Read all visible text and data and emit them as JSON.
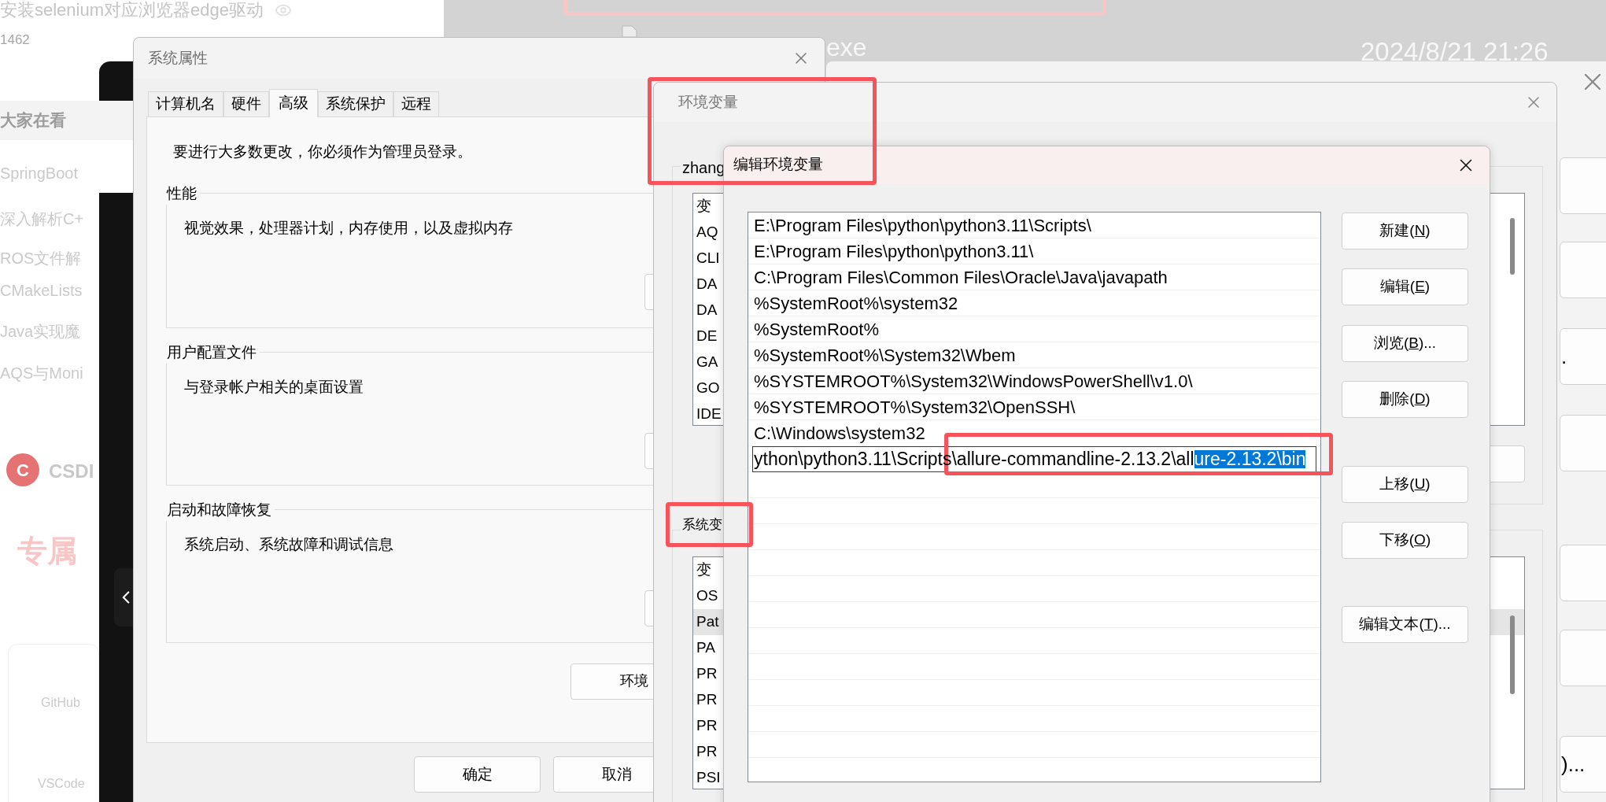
{
  "blog_page": {
    "article_title": "安装selenium对应浏览器edge驱动",
    "views": "1462",
    "section_title": "大家在看",
    "related": [
      "SpringBoot",
      "深入解析C+",
      "ROS文件解",
      "CMakeLists",
      "Java实现魔",
      "AQS与Moni"
    ],
    "logo_letter": "C",
    "brand": "CSDI",
    "banner": "专属",
    "cards": [
      "GitHub",
      "VSCode"
    ]
  },
  "desktop": {
    "file_name": "exe",
    "date": "2024/8/21 21:26"
  },
  "back_window": {
    "texts": [
      ".",
      ")..."
    ]
  },
  "system_properties": {
    "title": "系统属性",
    "tabs": [
      {
        "label": "计算机名",
        "selected": false
      },
      {
        "label": "硬件",
        "selected": false
      },
      {
        "label": "高级",
        "selected": true
      },
      {
        "label": "系统保护",
        "selected": false
      },
      {
        "label": "远程",
        "selected": false
      }
    ],
    "notice": "要进行大多数更改，你必须作为管理员登录。",
    "groups": [
      {
        "title": "性能",
        "description": "视觉效果，处理器计划，内存使用，以及虚拟内存"
      },
      {
        "title": "用户配置文件",
        "description": "与登录帐户相关的桌面设置"
      },
      {
        "title": "启动和故障恢复",
        "description": "系统启动、系统故障和调试信息"
      }
    ],
    "env_button": "环境",
    "buttons": [
      "确定",
      "取消"
    ]
  },
  "environment_variables": {
    "title": "环境变量",
    "user_section": "zhang",
    "user_list": {
      "header": "变",
      "rows": [
        {
          "name": "AQ",
          "selected": false
        },
        {
          "name": "CLI",
          "selected": false
        },
        {
          "name": "DA",
          "selected": false
        },
        {
          "name": "DA",
          "selected": false
        },
        {
          "name": "DE",
          "selected": false
        },
        {
          "name": "GA",
          "selected": false
        },
        {
          "name": "GO",
          "selected": false
        },
        {
          "name": "IDE",
          "selected": false
        }
      ]
    },
    "system_section": "系统变",
    "system_list": {
      "header": "变",
      "rows": [
        {
          "name": "OS",
          "selected": false
        },
        {
          "name": "Pat",
          "selected": true
        },
        {
          "name": "PA",
          "selected": false
        },
        {
          "name": "PR",
          "selected": false
        },
        {
          "name": "PR",
          "selected": false
        },
        {
          "name": "PR",
          "selected": false
        },
        {
          "name": "PR",
          "selected": false
        },
        {
          "name": "PSI",
          "selected": false
        }
      ]
    }
  },
  "edit_dialog": {
    "title": "编辑环境变量",
    "entries": [
      "E:\\Program Files\\python\\python3.11\\Scripts\\",
      "E:\\Program Files\\python\\python3.11\\",
      "C:\\Program Files\\Common Files\\Oracle\\Java\\javapath",
      "%SystemRoot%\\system32",
      "%SystemRoot%",
      "%SystemRoot%\\System32\\Wbem",
      "%SYSTEMROOT%\\System32\\WindowsPowerShell\\v1.0\\",
      "%SYSTEMROOT%\\System32\\OpenSSH\\",
      "C:\\Windows\\system32"
    ],
    "editing": {
      "text": "ython\\python3.11\\Scripts\\allure-commandline-2.13.2\\all",
      "selection": "ure-2.13.2\\bin"
    },
    "buttons": [
      {
        "before": "新建(",
        "key": "N",
        "after": ")"
      },
      {
        "before": "编辑(",
        "key": "E",
        "after": ")"
      },
      {
        "before": "浏览(",
        "key": "B",
        "after": ")..."
      },
      {
        "before": "删除(",
        "key": "D",
        "after": ")"
      },
      {
        "before": "上移(",
        "key": "U",
        "after": ")"
      },
      {
        "before": "下移(",
        "key": "O",
        "after": ")"
      },
      {
        "before": "编辑文本(",
        "key": "T",
        "after": ")..."
      }
    ]
  }
}
